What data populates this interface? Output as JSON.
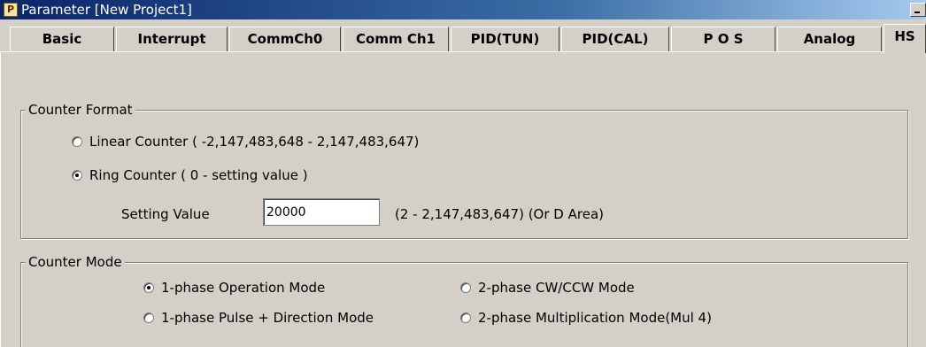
{
  "window": {
    "title": "Parameter [New Project1]"
  },
  "tabs": [
    {
      "label": "Basic"
    },
    {
      "label": "Interrupt"
    },
    {
      "label": "CommCh0"
    },
    {
      "label": "Comm Ch1"
    },
    {
      "label": "PID(TUN)"
    },
    {
      "label": "PID(CAL)"
    },
    {
      "label": "P O S"
    },
    {
      "label": "Analog"
    },
    {
      "label": "HS"
    }
  ],
  "counter_format": {
    "title": "Counter Format",
    "linear": {
      "label": "Linear Counter ( -2,147,483,648 - 2,147,483,647)",
      "checked": false
    },
    "ring": {
      "label": "Ring Counter ( 0 - setting value )",
      "checked": true
    },
    "setting_value": {
      "label": "Setting Value",
      "value": "20000",
      "range": "(2 - 2,147,483,647)   (Or D Area)"
    }
  },
  "counter_mode": {
    "title": "Counter Mode",
    "options": [
      {
        "label": "1-phase Operation Mode",
        "checked": true
      },
      {
        "label": "2-phase CW/CCW Mode",
        "checked": false
      },
      {
        "label": "1-phase Pulse + Direction Mode",
        "checked": false
      },
      {
        "label": "2-phase Multiplication Mode(Mul 4)",
        "checked": false
      }
    ]
  }
}
